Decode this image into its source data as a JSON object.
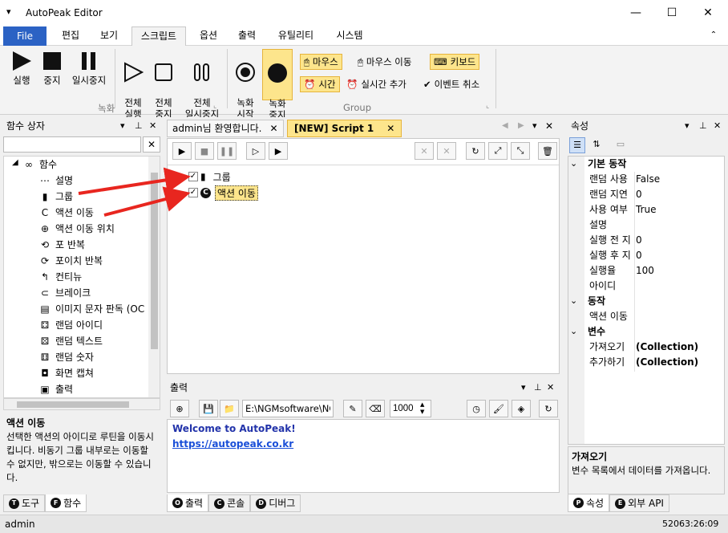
{
  "title_bar": {
    "menu_glyph": "▾",
    "title": "AutoPeak Editor",
    "minimize": "—",
    "maximize": "☐",
    "close": "✕"
  },
  "menu": {
    "tabs": [
      {
        "label": "File"
      },
      {
        "label": "편집"
      },
      {
        "label": "보기"
      },
      {
        "label": "스크립트"
      },
      {
        "label": "옵션"
      },
      {
        "label": "출력"
      },
      {
        "label": "유틸리티"
      },
      {
        "label": "시스템"
      }
    ],
    "collapse_glyph": "⌃"
  },
  "ribbon": {
    "run": "실행",
    "stop": "중지",
    "pause": "일시중지",
    "run_all": "전체\n실행",
    "stop_all": "전체\n중지",
    "pause_all": "전체\n일시중지",
    "group_record_label": "녹화",
    "record_start": "녹화\n시작",
    "record_stop": "녹화\n중지",
    "mouse": "마우스",
    "mouse_move": "마우스 이동",
    "keyboard": "키보드",
    "time": "시간",
    "realtime_add": "실시간 추가",
    "event_cancel": "이벤트 취소",
    "group_group_label": "Group",
    "launcher_glyph": "⌞"
  },
  "left_panel": {
    "title": "함수 상자",
    "search_placeholder": "",
    "clear_glyph": "✕",
    "root": "함수",
    "items": [
      {
        "label": "설명",
        "icon": "⋯"
      },
      {
        "label": "그룹",
        "icon": "▮"
      },
      {
        "label": "액션 이동",
        "icon": "C"
      },
      {
        "label": "액션 이동 위치",
        "icon": "⊕"
      },
      {
        "label": "포 반복",
        "icon": "⟲"
      },
      {
        "label": "포이치 반복",
        "icon": "⟳"
      },
      {
        "label": "컨티뉴",
        "icon": "↰"
      },
      {
        "label": "브레이크",
        "icon": "⊂"
      },
      {
        "label": "이미지 문자 판독 (OC",
        "icon": "▤"
      },
      {
        "label": "랜덤 아이디",
        "icon": "⚃"
      },
      {
        "label": "랜덤 텍스트",
        "icon": "⚄"
      },
      {
        "label": "랜덤 숫자",
        "icon": "⚅"
      },
      {
        "label": "화면 캡쳐",
        "icon": "◘"
      },
      {
        "label": "출력",
        "icon": "▣"
      }
    ],
    "desc_title": "액션 이동",
    "desc_text": "선택한 액션의 아이디로 루틴을 이동시킵니다. 비동기 그룹 내부로는 이동할 수 없지만, 밖으로는 이동할 수 있습니다.",
    "tabs": [
      {
        "letter": "T",
        "label": "도구"
      },
      {
        "letter": "F",
        "label": "함수"
      }
    ]
  },
  "editor": {
    "tabs": [
      {
        "label": "admin님 환영합니다."
      },
      {
        "label": "[NEW] Script 1"
      }
    ],
    "nodes": [
      {
        "label": "그룹"
      },
      {
        "label": "액션 이동"
      }
    ]
  },
  "output": {
    "title": "출력",
    "path": "E:\\NGMsoftware\\NG",
    "interval": "1000",
    "welcome": "Welcome to AutoPeak!",
    "link": "https://autopeak.co.kr",
    "tabs": [
      {
        "letter": "O",
        "label": "출력"
      },
      {
        "letter": "C",
        "label": "콘솔"
      },
      {
        "letter": "D",
        "label": "디버그"
      }
    ]
  },
  "properties": {
    "title": "속성",
    "categories": [
      {
        "name": "기본 동작",
        "rows": [
          {
            "k": "랜덤 사용",
            "v": "False"
          },
          {
            "k": "랜덤 지연",
            "v": "0"
          },
          {
            "k": "사용 여부",
            "v": "True"
          },
          {
            "k": "설명",
            "v": ""
          },
          {
            "k": "실행 전 지",
            "v": "0"
          },
          {
            "k": "실행 후 지",
            "v": "0"
          },
          {
            "k": "실행율",
            "v": "100"
          },
          {
            "k": "아이디",
            "v": ""
          }
        ]
      },
      {
        "name": "동작",
        "rows": [
          {
            "k": "액션 이동",
            "v": ""
          }
        ]
      },
      {
        "name": "변수",
        "rows": [
          {
            "k": "가져오기",
            "v": "(Collection)"
          },
          {
            "k": "추가하기",
            "v": "(Collection)"
          }
        ]
      }
    ],
    "desc_title": "가져오기",
    "desc_text": "변수 목록에서 데이터를 가져옵니다.",
    "tabs": [
      {
        "letter": "P",
        "label": "속성"
      },
      {
        "letter": "E",
        "label": "외부 API"
      }
    ]
  },
  "status": {
    "user": "admin",
    "clock": "52063:26:09"
  },
  "colors": {
    "accent": "#2b62c4",
    "highlight": "#fde58c",
    "highlight_border": "#e6b43c",
    "arrow": "#e8261f",
    "link": "#1a4fd8",
    "welcome": "#2233aa"
  }
}
